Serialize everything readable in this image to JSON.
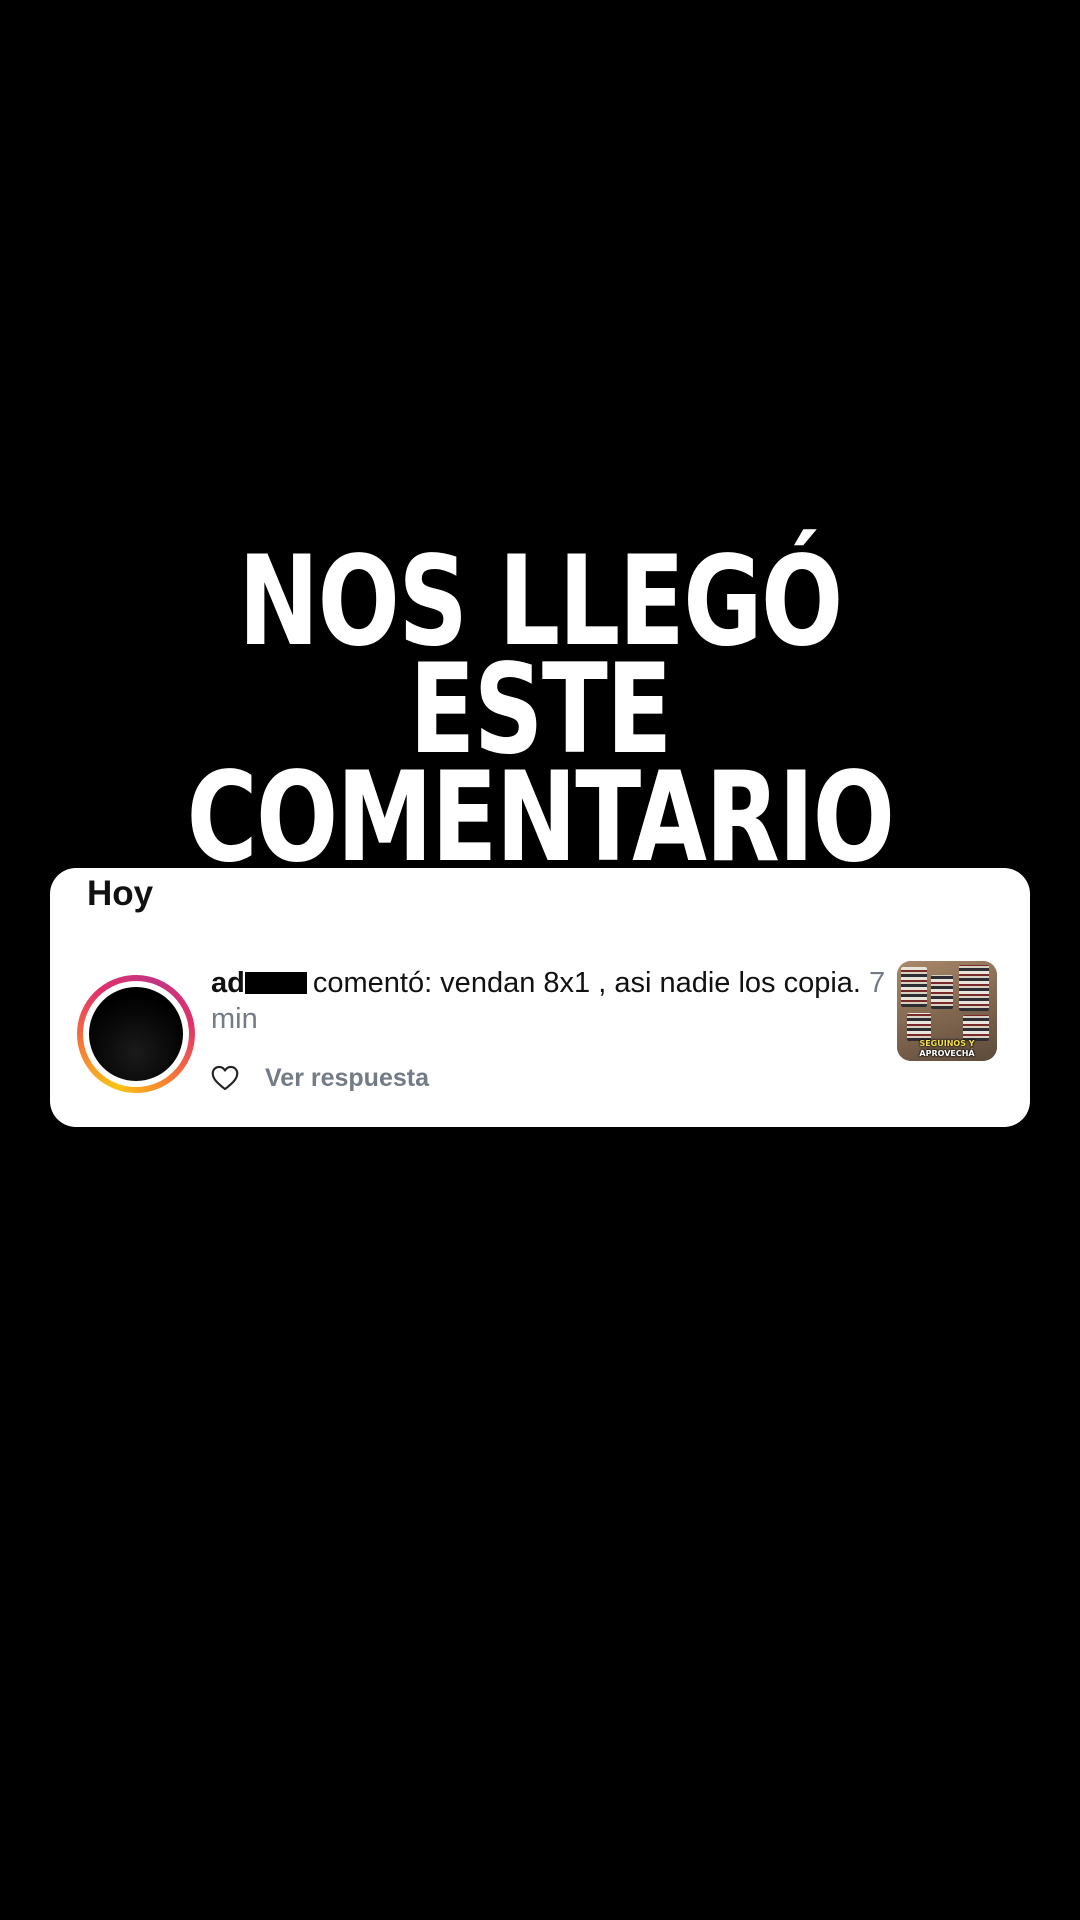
{
  "headline": {
    "line1": "NOS LLEGÓ ESTE",
    "line2": "COMENTARIO"
  },
  "notification": {
    "section_title": "Hoy",
    "username_visible": "ad",
    "comment_text": "comentó: vendan 8x1 , asi nadie los copia.",
    "time": "7 min",
    "reply_label": "Ver respuesta",
    "like_icon": "heart-outline-icon",
    "thumbnail_caption_line1": "SEGUINOS Y",
    "thumbnail_caption_line2": "APROVECHÁ"
  },
  "colors": {
    "background": "#000000",
    "card": "#ffffff",
    "muted_text": "#737b86",
    "story_ring_start": "#f9c513",
    "story_ring_end": "#e1306c"
  }
}
